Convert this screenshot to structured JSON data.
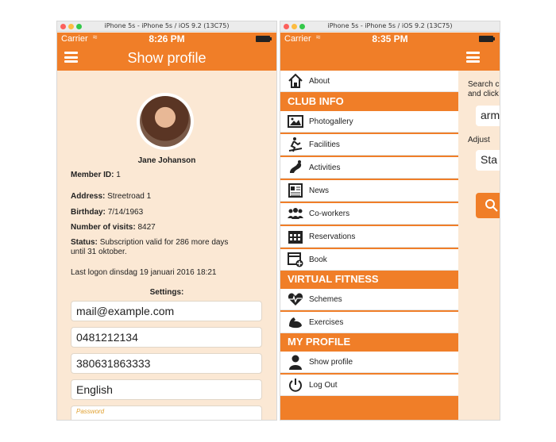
{
  "left": {
    "window_title": "iPhone 5s - iPhone 5s / iOS 9.2 (13C75)",
    "status": {
      "carrier": "Carrier",
      "time": "8:26 PM"
    },
    "nav_title": "Show profile",
    "profile": {
      "name": "Jane Johanson",
      "member_id_label": "Member ID:",
      "member_id": "1",
      "address_label": "Address:",
      "address": "Streetroad 1",
      "birthday_label": "Birthday:",
      "birthday": "7/14/1963",
      "visits_label": "Number of visits:",
      "visits": "8427",
      "status_label": "Status:",
      "status_line1": "Subscription valid for 286 more days",
      "status_line2": "until 31 oktober.",
      "last_logon": "Last logon dinsdag 19 januari 2016 18:21"
    },
    "settings_label": "Settings:",
    "fields": {
      "email": "mail@example.com",
      "phone1": "0481212134",
      "phone2": "380631863333",
      "language": "English",
      "password_placeholder": "Password"
    }
  },
  "right": {
    "window_title": "iPhone 5s - iPhone 5s / iOS 9.2 (13C75)",
    "status": {
      "carrier": "Carrier",
      "time": "8:35 PM"
    },
    "menu": {
      "about": "About",
      "club_info": "CLUB INFO",
      "photogallery": "Photogallery",
      "facilities": "Facilities",
      "activities": "Activities",
      "news": "News",
      "coworkers": "Co-workers",
      "reservations": "Reservations",
      "book": "Book",
      "virtual_fitness": "VIRTUAL FITNESS",
      "schemes": "Schemes",
      "exercises": "Exercises",
      "my_profile": "MY PROFILE",
      "show_profile": "Show profile",
      "log_out": "Log Out"
    },
    "behind": {
      "search_line1": "Search c",
      "search_line2": "and click",
      "field1": "arm",
      "adjust": "Adjust",
      "field2": "Sta"
    }
  },
  "colors": {
    "accent": "#f07e28",
    "background": "#fbe8d4"
  }
}
